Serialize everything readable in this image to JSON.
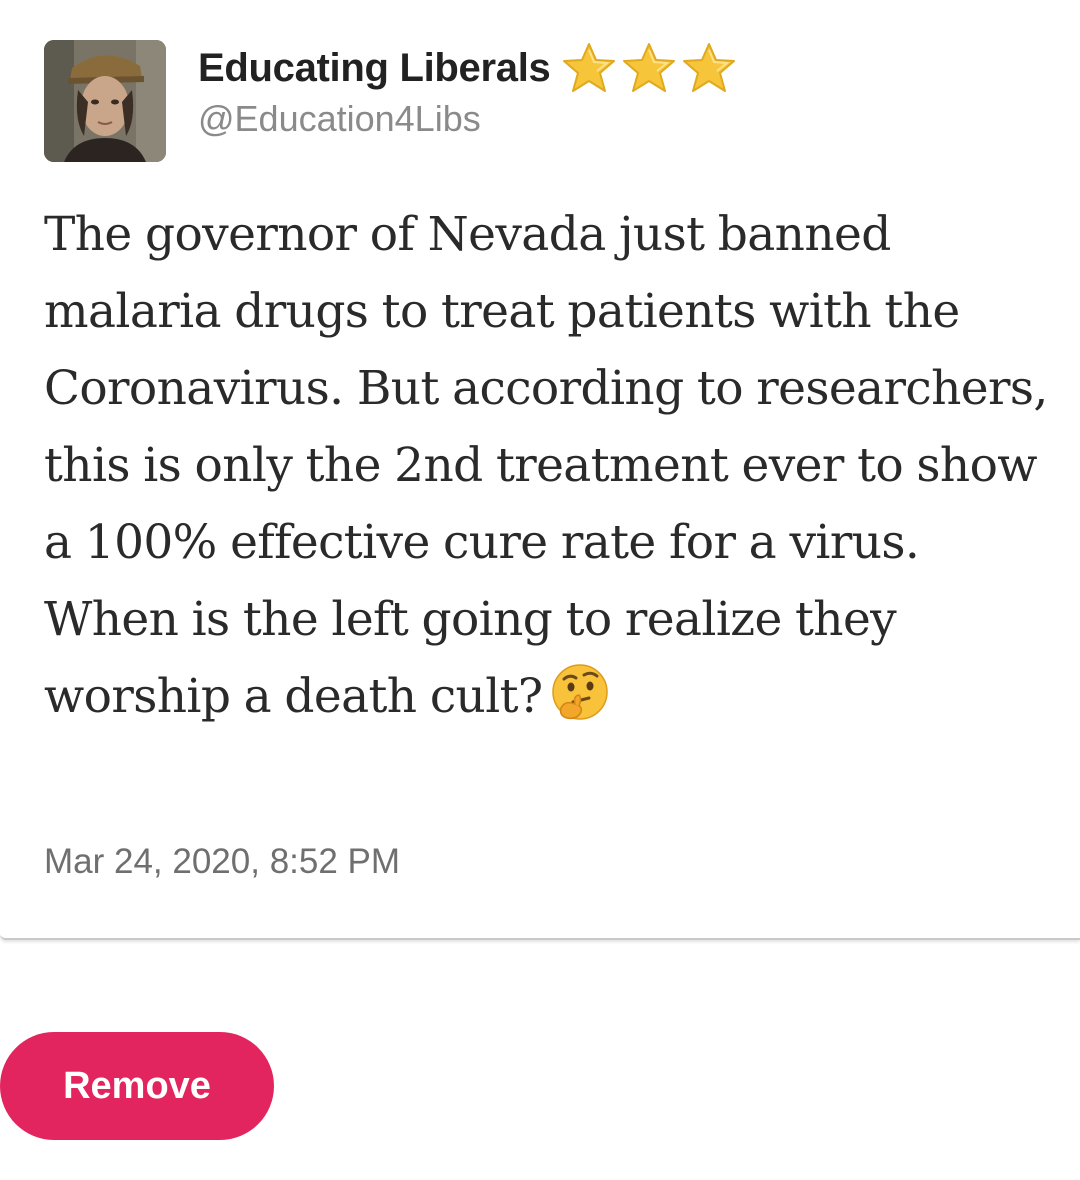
{
  "tweet": {
    "display_name": "Educating Liberals",
    "handle": "@Education4Libs",
    "badges": [
      "star-icon",
      "star-icon",
      "star-icon"
    ],
    "text": "The governor of Nevada just banned malaria drugs to treat patients with the Coronavirus. But according to researchers, this is only the 2nd treatment ever to show a 100% effective cure rate for a virus. When is the left going to realize they worship a death cult?",
    "emoji": "thinking-face-icon",
    "timestamp": "Mar 24, 2020, 8:52 PM"
  },
  "actions": {
    "remove_label": "Remove"
  },
  "colors": {
    "remove_button": "#e3255f",
    "star_fill": "#f7c53a",
    "handle_text": "#8a8a8a",
    "timestamp_text": "#6f6f6f"
  }
}
